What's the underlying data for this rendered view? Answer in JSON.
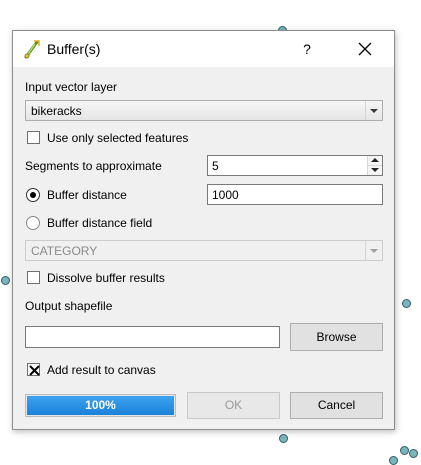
{
  "dialog": {
    "title": "Buffer(s)",
    "help_label": "?"
  },
  "input_layer": {
    "label": "Input vector layer",
    "value": "bikeracks"
  },
  "selected_only": {
    "label": "Use only selected features",
    "checked": false
  },
  "segments": {
    "label": "Segments to approximate",
    "value": "5"
  },
  "buffer_distance": {
    "label": "Buffer distance",
    "value": "1000",
    "selected": true
  },
  "buffer_field": {
    "label": "Buffer distance field",
    "value": "CATEGORY",
    "selected": false
  },
  "dissolve": {
    "label": "Dissolve buffer results",
    "checked": false
  },
  "output": {
    "label": "Output shapefile",
    "value": "",
    "browse_label": "Browse"
  },
  "add_to_canvas": {
    "label": "Add result to canvas",
    "checked": true
  },
  "progress": {
    "value": 1.0,
    "text": "100%"
  },
  "buttons": {
    "ok_label": "OK",
    "cancel_label": "Cancel"
  },
  "colors": {
    "point_fill": "#79b5bb",
    "progress_fill": "#1a82d8"
  }
}
